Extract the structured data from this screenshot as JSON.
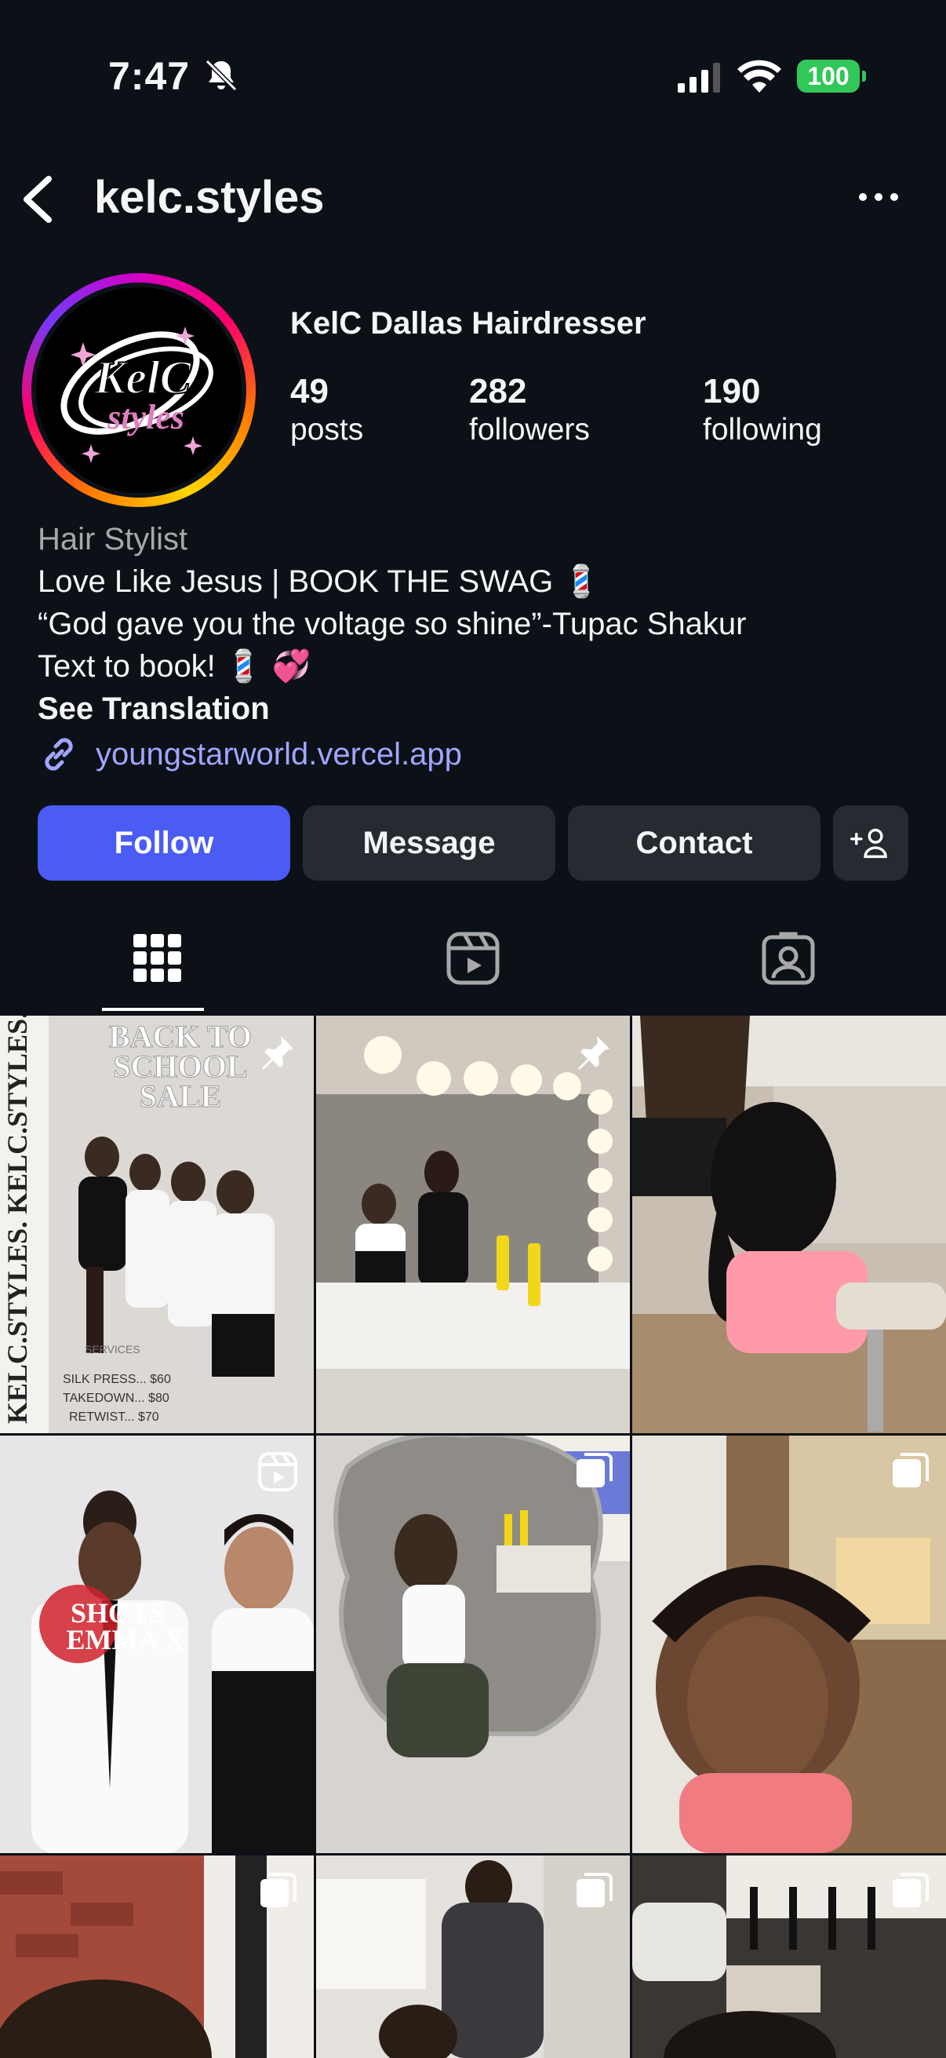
{
  "status_bar": {
    "time": "7:47",
    "battery": "100"
  },
  "nav": {
    "username": "kelc.styles"
  },
  "profile": {
    "display_name": "KelC Dallas Hairdresser",
    "stats": [
      {
        "value": "49",
        "label": "posts"
      },
      {
        "value": "282",
        "label": "followers"
      },
      {
        "value": "190",
        "label": "following"
      }
    ],
    "category": "Hair Stylist",
    "bio_lines": [
      "Love Like Jesus | BOOK THE SWAG 💈",
      "“God gave you the voltage so shine”-Tupac Shakur",
      "Text to book! 💈 💞"
    ],
    "see_translation": "See Translation",
    "link": "youngstarworld.vercel.app",
    "avatar_logo_text": "KelC styles"
  },
  "actions": {
    "follow": "Follow",
    "message": "Message",
    "contact": "Contact"
  },
  "tabs": [
    "posts-grid",
    "reels",
    "tagged"
  ],
  "posts": [
    {
      "type": "pinned",
      "image_text": [
        "BACK TO",
        "SCHOOL",
        "SALE",
        "KELC.STYLES. KELC.STYLES.",
        "SERVICES",
        "SILK PRESS... $60",
        "TAKEDOWN... $80",
        "RETWIST... $70"
      ]
    },
    {
      "type": "pinned"
    },
    {
      "type": "none"
    },
    {
      "type": "reel",
      "image_text": [
        "SHOTS",
        "EMMA X"
      ]
    },
    {
      "type": "carousel"
    },
    {
      "type": "carousel"
    },
    {
      "type": "carousel"
    },
    {
      "type": "carousel"
    },
    {
      "type": "carousel"
    }
  ],
  "colors": {
    "background": "#0c1017",
    "follow_button": "#4a5cf4",
    "link": "#a0a6ff",
    "secondary_button": "#262a31"
  }
}
